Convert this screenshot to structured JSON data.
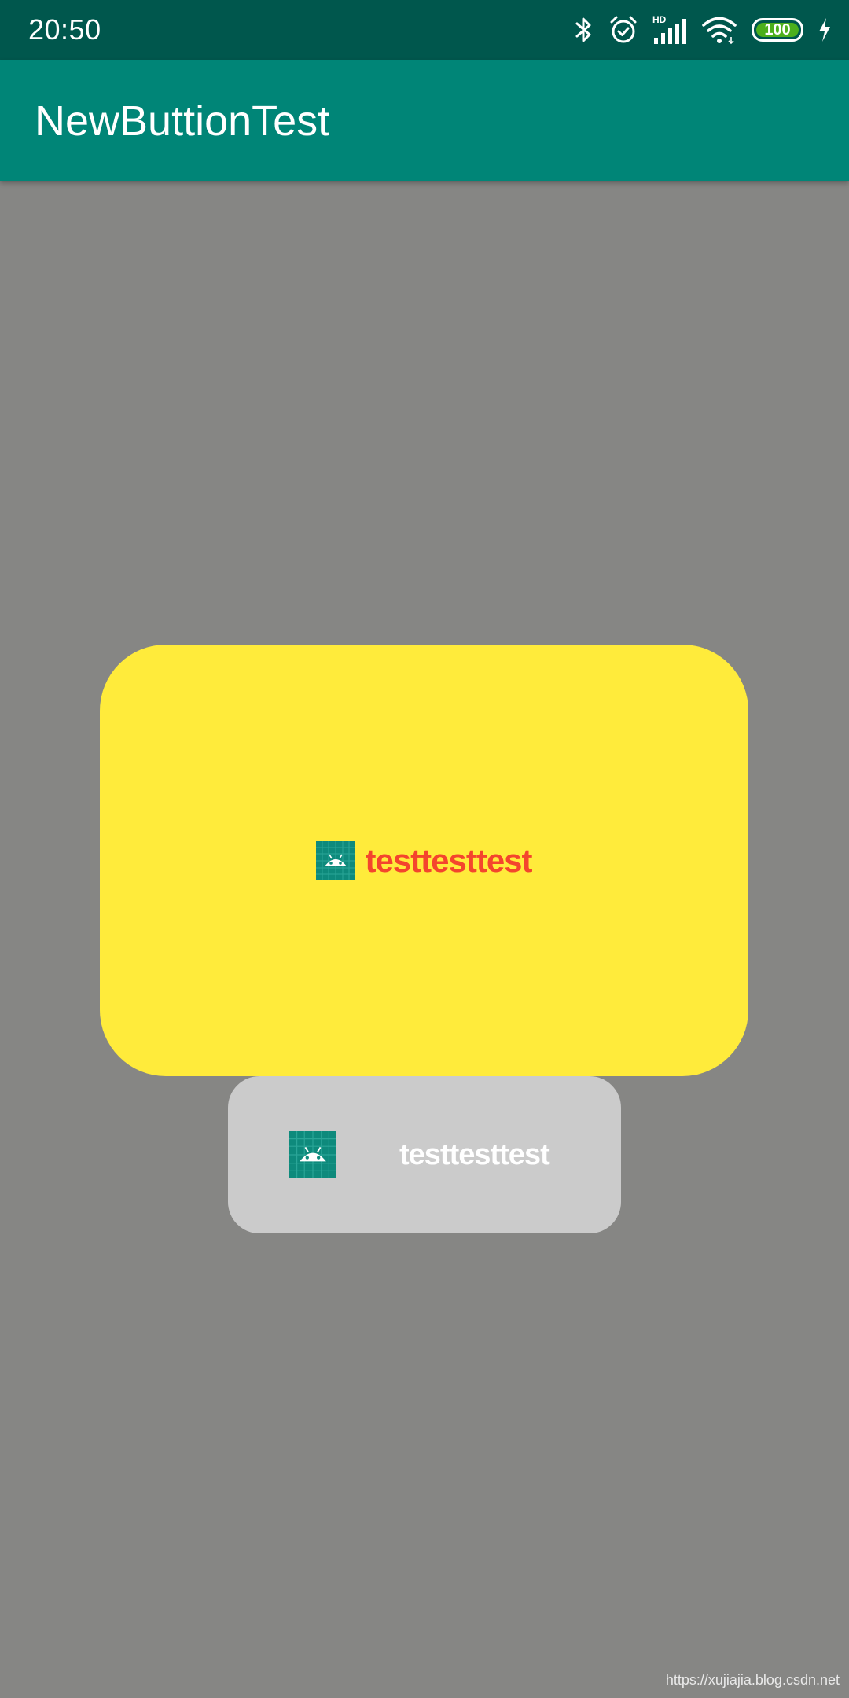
{
  "status_bar": {
    "time": "20:50",
    "battery_level": "100",
    "icons": [
      "bluetooth-icon",
      "alarm-icon",
      "hd-signal-icon",
      "wifi-icon",
      "battery-icon",
      "charging-icon"
    ]
  },
  "app_bar": {
    "title": "NewButtionTest"
  },
  "buttons": [
    {
      "label": "testtesttest",
      "icon": "android-launcher-icon",
      "background": "#ffeb3b",
      "text_color": "#f4452d"
    },
    {
      "label": "testtesttest",
      "icon": "android-launcher-icon",
      "background": "#cbcbcb",
      "text_color": "#ffffff"
    }
  ],
  "colors": {
    "status_bar": "#00574d",
    "primary": "#008577",
    "background": "#868684"
  },
  "watermark": "https://xujiajia.blog.csdn.net"
}
